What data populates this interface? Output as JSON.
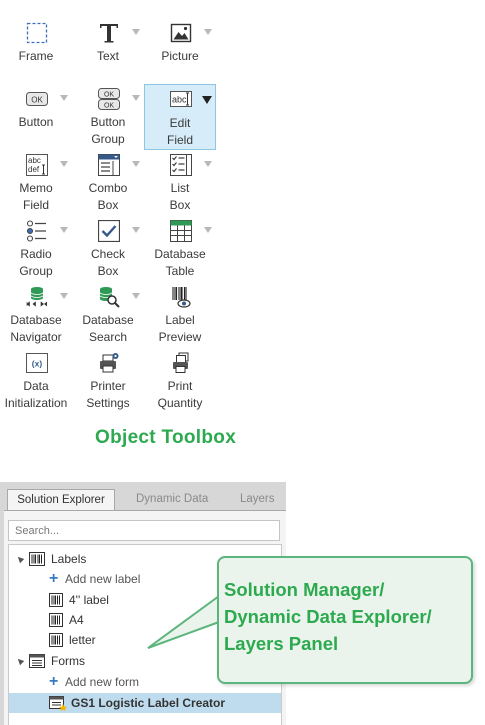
{
  "toolbox": {
    "title": "Object Toolbox",
    "tools": {
      "frame": "Frame",
      "text": "Text",
      "picture": "Picture",
      "button": "Button",
      "button_group": "Button\nGroup",
      "edit_field": "Edit\nField",
      "memo_field": "Memo\nField",
      "combo_box": "Combo\nBox",
      "list_box": "List\nBox",
      "radio_group": "Radio\nGroup",
      "check_box": "Check\nBox",
      "database_table": "Database\nTable",
      "database_navigator": "Database\nNavigator",
      "database_search": "Database\nSearch",
      "label_preview": "Label\nPreview",
      "data_initialization": "Data\nInitialization",
      "printer_settings": "Printer\nSettings",
      "print_quantity": "Print\nQuantity"
    },
    "icon_text": {
      "button_ok": "OK",
      "edit_abc": "abc",
      "memo_abc": "abc",
      "memo_def": "def",
      "data_init": "(x)"
    }
  },
  "explorer": {
    "tabs": [
      "Solution Explorer",
      "Dynamic Data",
      "Layers"
    ],
    "search_placeholder": "Search...",
    "tree": {
      "labels": "Labels",
      "add_label": "Add new label",
      "items": [
        "4'' label",
        "A4",
        "letter"
      ],
      "forms": "Forms",
      "add_form": "Add new form",
      "form_items": [
        "GS1 Logistic Label Creator"
      ]
    }
  },
  "callout": {
    "text": "Solution Manager/\nDynamic Data Explorer/\nLayers Panel"
  },
  "colors": {
    "accent_green": "#2daa4f",
    "selection_blue": "#d6ecf8",
    "tree_selection": "#bfdcee"
  }
}
